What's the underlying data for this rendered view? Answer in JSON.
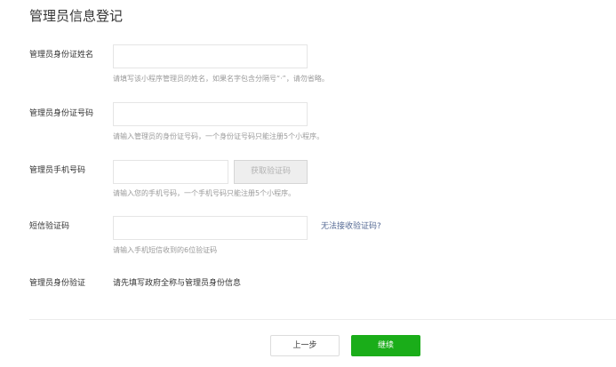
{
  "page": {
    "title": "管理员信息登记"
  },
  "form": {
    "name": {
      "label": "管理员身份证姓名",
      "value": "",
      "hint": "请填写该小程序管理员的姓名，如果名字包含分隔号“·”，请勿省略。"
    },
    "id_number": {
      "label": "管理员身份证号码",
      "value": "",
      "hint": "请输入管理员的身份证号码，一个身份证号码只能注册5个小程序。"
    },
    "phone": {
      "label": "管理员手机号码",
      "value": "",
      "button_label": "获取验证码",
      "hint": "请输入您的手机号码，一个手机号码只能注册5个小程序。"
    },
    "sms_code": {
      "label": "短信验证码",
      "value": "",
      "link_label": "无法接收验证码?",
      "hint": "请输入手机短信收到的6位验证码"
    },
    "identity_verify": {
      "label": "管理员身份验证",
      "text": "请先填写政府全称与管理员身份信息"
    }
  },
  "footer": {
    "prev_label": "上一步",
    "next_label": "继续"
  },
  "colors": {
    "primary_green": "#1aad19",
    "link_blue": "#576b95",
    "hint_gray": "#9a9a9a"
  }
}
